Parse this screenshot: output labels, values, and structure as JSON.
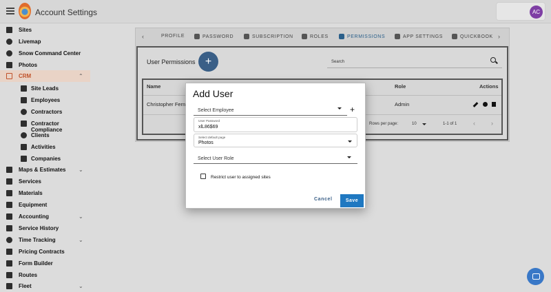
{
  "app": {
    "title": "Account Settings",
    "avatar_initials": "AC"
  },
  "sidebar": {
    "items": [
      {
        "label": "Sites",
        "icon": "building-icon"
      },
      {
        "label": "Livemap",
        "icon": "globe-icon"
      },
      {
        "label": "Snow Command Center",
        "icon": "snowflake-icon"
      },
      {
        "label": "Photos",
        "icon": "image-icon"
      },
      {
        "label": "CRM",
        "icon": "crm-icon",
        "active": true,
        "expanded": true
      },
      {
        "label": "Site Leads",
        "icon": "leads-icon",
        "sub": true
      },
      {
        "label": "Employees",
        "icon": "badge-icon",
        "sub": true
      },
      {
        "label": "Contractors",
        "icon": "person-icon",
        "sub": true
      },
      {
        "label": "Contractor Compliance",
        "icon": "shield-icon",
        "sub": true
      },
      {
        "label": "Clients",
        "icon": "client-icon",
        "sub": true
      },
      {
        "label": "Activities",
        "icon": "calendar-icon",
        "sub": true
      },
      {
        "label": "Companies",
        "icon": "company-icon",
        "sub": true
      },
      {
        "label": "Maps & Estimates",
        "icon": "map-icon",
        "expandable": true
      },
      {
        "label": "Services",
        "icon": "wrench-icon"
      },
      {
        "label": "Materials",
        "icon": "materials-icon"
      },
      {
        "label": "Equipment",
        "icon": "equipment-icon"
      },
      {
        "label": "Accounting",
        "icon": "accounting-icon",
        "expandable": true
      },
      {
        "label": "Service History",
        "icon": "history-icon"
      },
      {
        "label": "Time Tracking",
        "icon": "clock-icon",
        "expandable": true
      },
      {
        "label": "Pricing Contracts",
        "icon": "dollar-icon"
      },
      {
        "label": "Form Builder",
        "icon": "form-icon"
      },
      {
        "label": "Routes",
        "icon": "signpost-icon"
      },
      {
        "label": "Fleet",
        "icon": "truck-icon",
        "expandable": true
      }
    ]
  },
  "tabs": [
    {
      "label": "PROFILE",
      "icon": ""
    },
    {
      "label": "PASSWORD",
      "icon": "password-icon"
    },
    {
      "label": "SUBSCRIPTION",
      "icon": "subscription-icon"
    },
    {
      "label": "ROLES",
      "icon": "roles-icon"
    },
    {
      "label": "PERMISSIONS",
      "icon": "permissions-icon",
      "active": true
    },
    {
      "label": "APP SETTINGS",
      "icon": "tag-icon"
    },
    {
      "label": "QUICKBOOK",
      "icon": "quickbook-icon"
    }
  ],
  "permissions": {
    "title": "User Permissions",
    "search_placeholder": "Search",
    "columns": {
      "name": "Name",
      "role": "Role",
      "actions": "Actions"
    },
    "rows": [
      {
        "name": "Christopher Fern",
        "role": "Admin"
      }
    ],
    "pagination": {
      "rows_per_page_label": "Rows per page:",
      "rows_per_page": "10",
      "range": "1-1 of 1"
    }
  },
  "dialog": {
    "title": "Add User",
    "employee_placeholder": "Select Employee",
    "password_label": "User Password",
    "password_value": "xlL86$69",
    "default_page_label": "Select default page",
    "default_page_value": "Photos",
    "role_placeholder": "Select User Role",
    "restrict_label": "Restrict user to assigned sites",
    "cancel_label": "Cancel",
    "save_label": "Save"
  },
  "colors": {
    "accent": "#1f78c1",
    "crm_active": "#c0522a",
    "fab": "#3a5f87",
    "avatar": "#7e3ea4"
  }
}
